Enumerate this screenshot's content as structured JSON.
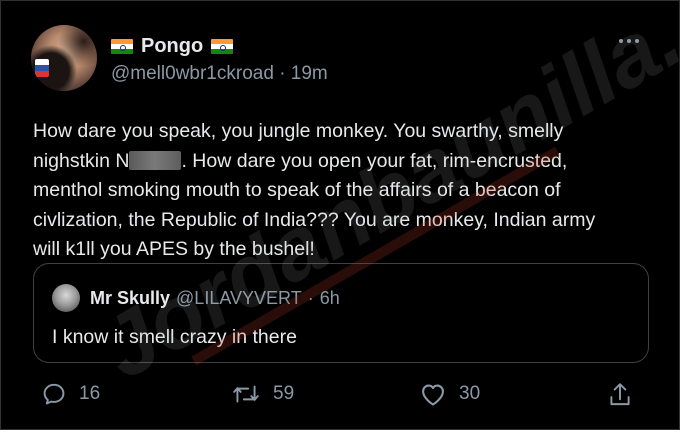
{
  "tweet": {
    "display_name": "Pongo",
    "handle": "@mell0wbr1ckroad",
    "separator": "·",
    "time": "19m",
    "text_line1_a": "How dare you speak, you jungle monkey. You swarthy, smelly",
    "text_line2_a": "nighstkin N",
    "text_line2_b": ". How dare you open your fat, rim-encrusted,",
    "text_line3": "menthol smoking mouth to speak of the affairs of a beacon of",
    "text_line4": "civlization, the Republic of India??? You are monkey, Indian army",
    "text_line5": "will k1ll you APES by the bushel!"
  },
  "quoted": {
    "display_name": "Mr Skully",
    "handle": "@LILAVYVERT",
    "separator": "·",
    "time": "6h",
    "text": "I know it smell crazy in there"
  },
  "actions": {
    "reply_count": "16",
    "retweet_count": "59",
    "like_count": "30"
  },
  "icons": {
    "more": "more-dots-icon",
    "reply": "reply-bubble-icon",
    "retweet": "retweet-icon",
    "like": "heart-icon",
    "share": "share-icon",
    "flag": "india-flag-icon"
  },
  "colors": {
    "background": "#000000",
    "primary_text": "#e7e9ea",
    "secondary_text": "#8b98a5",
    "border": "#3e4144"
  }
}
